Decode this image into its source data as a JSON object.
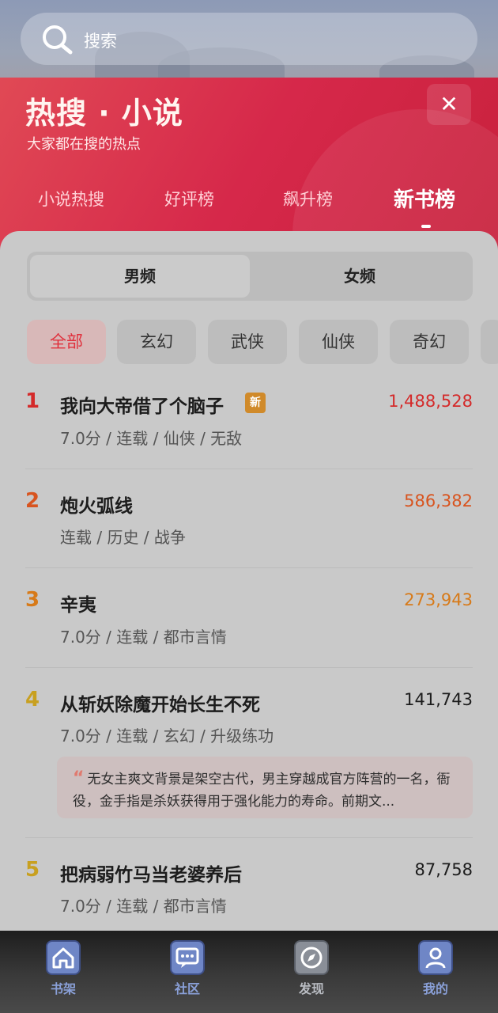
{
  "search": {
    "placeholder": "搜索"
  },
  "header": {
    "title": "热搜 · 小说",
    "subtitle": "大家都在搜的热点",
    "close_label": "✕",
    "tabs": [
      {
        "label": "小说热搜",
        "active": false
      },
      {
        "label": "好评榜",
        "active": false
      },
      {
        "label": "飙升榜",
        "active": false
      },
      {
        "label": "新书榜",
        "active": true
      }
    ]
  },
  "gender": {
    "options": [
      "男频",
      "女频"
    ],
    "selected": "男频"
  },
  "categories": {
    "items": [
      "全部",
      "玄幻",
      "武侠",
      "仙侠",
      "奇幻"
    ],
    "selected": "全部"
  },
  "books": [
    {
      "rank": "1",
      "title": "我向大帝借了个脑子",
      "badge": "新",
      "count": "1,488,528",
      "meta": "7.0分 / 连载 / 仙侠 / 无敌",
      "rank_color": "#d42a2a"
    },
    {
      "rank": "2",
      "title": "炮火弧线",
      "count": "586,382",
      "meta": "连载 / 历史 / 战争",
      "rank_color": "#d8541f"
    },
    {
      "rank": "3",
      "title": "辛夷",
      "count": "273,943",
      "meta": "7.0分 / 连载 / 都市言情",
      "rank_color": "#d77a19"
    },
    {
      "rank": "4",
      "title": "从斩妖除魔开始长生不死",
      "count": "141,743",
      "meta": "7.0分 / 连载 / 玄幻 / 升级练功",
      "rank_color": "#c8a020",
      "quote": "无女主爽文背景是架空古代，男主穿越成官方阵营的一名，衙役，金手指是杀妖获得用于强化能力的寿命。前期文..."
    },
    {
      "rank": "5",
      "title": "把病弱竹马当老婆养后",
      "count": "87,758",
      "meta": "7.0分 / 连载 / 都市言情",
      "rank_color": "#c8a020"
    }
  ],
  "nav": [
    {
      "label": "书架",
      "icon": "home-icon"
    },
    {
      "label": "社区",
      "icon": "chat-icon"
    },
    {
      "label": "发现",
      "icon": "compass-icon"
    },
    {
      "label": "我的",
      "icon": "user-icon"
    }
  ]
}
